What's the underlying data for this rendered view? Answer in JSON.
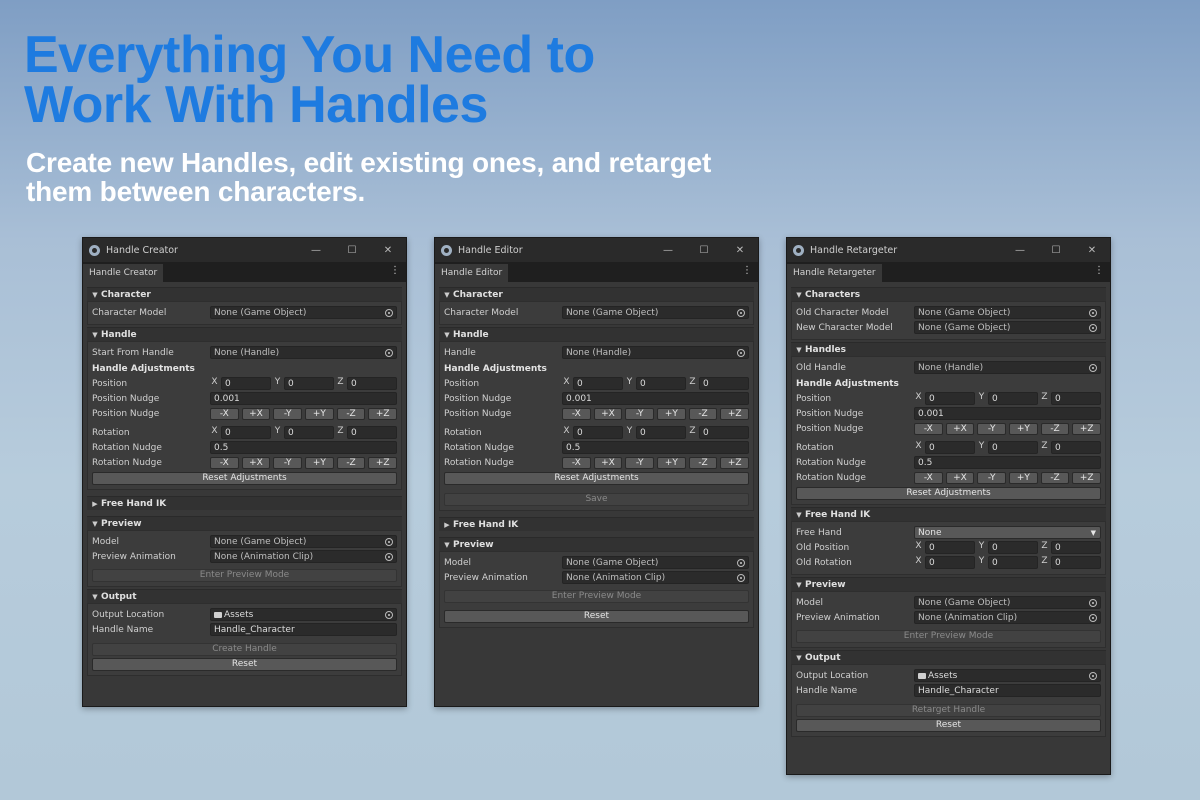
{
  "hero": {
    "title_line1": "Everything You Need to",
    "title_line2": "Work With Handles",
    "subtitle_line1": "Create new Handles, edit existing ones, and retarget",
    "subtitle_line2": "them between characters."
  },
  "window_controls": {
    "minimize": "—",
    "maximize": "☐",
    "close": "✕",
    "menu": "⋮"
  },
  "icons": {
    "window_icon": "unity-gear-icon",
    "picker": "object-picker-icon",
    "folder": "folder-icon",
    "foldout_open": "▼",
    "foldout_closed": "▶",
    "dropdown": "▼"
  },
  "axes": {
    "x": "X",
    "y": "Y",
    "z": "Z"
  },
  "nudge_buttons": [
    "-X",
    "+X",
    "-Y",
    "+Y",
    "-Z",
    "+Z"
  ],
  "creator": {
    "title": "Handle Creator",
    "tab": "Handle Creator",
    "character": {
      "header": "Character",
      "model_label": "Character Model",
      "model_value": "None (Game Object)"
    },
    "handle": {
      "header": "Handle",
      "start_label": "Start From Handle",
      "start_value": "None (Handle)",
      "adjust_header": "Handle Adjustments",
      "position_label": "Position",
      "position": [
        "0",
        "0",
        "0"
      ],
      "pos_nudge_label": "Position Nudge",
      "pos_nudge_value": "0.001",
      "pos_nudge_btn_label": "Position Nudge",
      "rotation_label": "Rotation",
      "rotation": [
        "0",
        "0",
        "0"
      ],
      "rot_nudge_label": "Rotation Nudge",
      "rot_nudge_value": "0.5",
      "rot_nudge_btn_label": "Rotation Nudge",
      "reset_adjust": "Reset Adjustments"
    },
    "free_hand_ik": {
      "header": "Free Hand IK"
    },
    "preview": {
      "header": "Preview",
      "model_label": "Model",
      "model_value": "None (Game Object)",
      "anim_label": "Preview Animation",
      "anim_value": "None (Animation Clip)",
      "enter_button": "Enter Preview Mode"
    },
    "output": {
      "header": "Output",
      "location_label": "Output Location",
      "location_value": "Assets",
      "name_label": "Handle Name",
      "name_value": "Handle_Character",
      "create_button": "Create Handle"
    },
    "reset": "Reset"
  },
  "editor": {
    "title": "Handle Editor",
    "tab": "Handle Editor",
    "character": {
      "header": "Character",
      "model_label": "Character Model",
      "model_value": "None (Game Object)"
    },
    "handle": {
      "header": "Handle",
      "handle_label": "Handle",
      "handle_value": "None (Handle)",
      "adjust_header": "Handle Adjustments",
      "position_label": "Position",
      "position": [
        "0",
        "0",
        "0"
      ],
      "pos_nudge_label": "Position Nudge",
      "pos_nudge_value": "0.001",
      "pos_nudge_btn_label": "Position Nudge",
      "rotation_label": "Rotation",
      "rotation": [
        "0",
        "0",
        "0"
      ],
      "rot_nudge_label": "Rotation Nudge",
      "rot_nudge_value": "0.5",
      "rot_nudge_btn_label": "Rotation Nudge",
      "reset_adjust": "Reset Adjustments",
      "save": "Save"
    },
    "free_hand_ik": {
      "header": "Free Hand IK"
    },
    "preview": {
      "header": "Preview",
      "model_label": "Model",
      "model_value": "None (Game Object)",
      "anim_label": "Preview Animation",
      "anim_value": "None (Animation Clip)",
      "enter_button": "Enter Preview Mode"
    },
    "reset": "Reset"
  },
  "retargeter": {
    "title": "Handle Retargeter",
    "tab": "Handle Retargeter",
    "characters": {
      "header": "Characters",
      "old_label": "Old Character Model",
      "old_value": "None (Game Object)",
      "new_label": "New Character Model",
      "new_value": "None (Game Object)"
    },
    "handles": {
      "header": "Handles",
      "old_label": "Old Handle",
      "old_value": "None (Handle)",
      "adjust_header": "Handle Adjustments",
      "position_label": "Position",
      "position": [
        "0",
        "0",
        "0"
      ],
      "pos_nudge_label": "Position Nudge",
      "pos_nudge_value": "0.001",
      "pos_nudge_btn_label": "Position Nudge",
      "rotation_label": "Rotation",
      "rotation": [
        "0",
        "0",
        "0"
      ],
      "rot_nudge_label": "Rotation Nudge",
      "rot_nudge_value": "0.5",
      "rot_nudge_btn_label": "Rotation Nudge",
      "reset_adjust": "Reset Adjustments"
    },
    "free_hand_ik": {
      "header": "Free Hand IK",
      "free_hand_label": "Free Hand",
      "free_hand_value": "None",
      "old_pos_label": "Old Position",
      "old_pos": [
        "0",
        "0",
        "0"
      ],
      "old_rot_label": "Old Rotation",
      "old_rot": [
        "0",
        "0",
        "0"
      ]
    },
    "preview": {
      "header": "Preview",
      "model_label": "Model",
      "model_value": "None (Game Object)",
      "anim_label": "Preview Animation",
      "anim_value": "None (Animation Clip)",
      "enter_button": "Enter Preview Mode"
    },
    "output": {
      "header": "Output",
      "location_label": "Output Location",
      "location_value": "Assets",
      "name_label": "Handle Name",
      "name_value": "Handle_Character",
      "retarget_button": "Retarget Handle"
    },
    "reset": "Reset"
  }
}
